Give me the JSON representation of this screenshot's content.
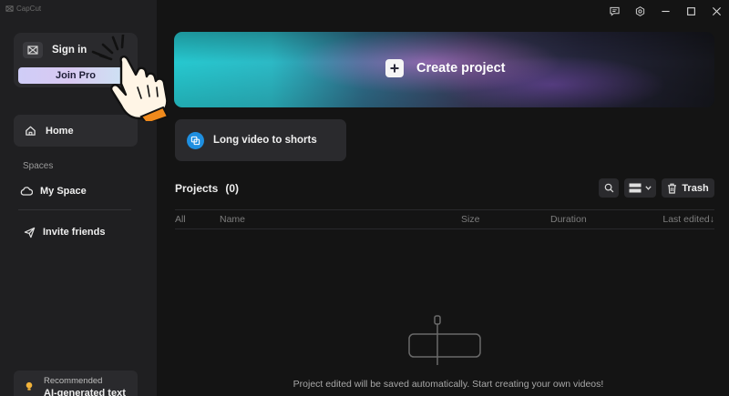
{
  "app": {
    "title": "CapCut"
  },
  "sidebar": {
    "sign_in_label": "Sign in",
    "join_pro_label": "Join Pro",
    "home_label": "Home",
    "spaces_section": "Spaces",
    "my_space_label": "My Space",
    "invite_label": "Invite friends",
    "recommended_label": "Recommended",
    "recommended_title": "AI-generated text"
  },
  "main": {
    "create_project_label": "Create project",
    "long_video_label": "Long video to shorts",
    "projects_title": "Projects",
    "projects_count": "(0)",
    "trash_label": "Trash",
    "columns": {
      "all": "All",
      "name": "Name",
      "size": "Size",
      "duration": "Duration",
      "last_edited": "Last edited↓"
    },
    "empty_message": "Project edited will be saved automatically. Start creating your own videos!"
  },
  "colors": {
    "accent_blue": "#1e8fe0",
    "hand_cuff": "#f08a1c",
    "banner_teal": "#26c8cf"
  },
  "icons": [
    "capcut-logo-icon",
    "feedback-icon",
    "settings-icon",
    "minimize-icon",
    "maximize-icon",
    "close-icon",
    "home-icon",
    "cloud-icon",
    "send-icon",
    "bulb-icon",
    "plus-icon",
    "shorts-icon",
    "search-icon",
    "list-view-icon",
    "chevron-down-icon",
    "trash-icon",
    "pointing-hand-icon"
  ]
}
